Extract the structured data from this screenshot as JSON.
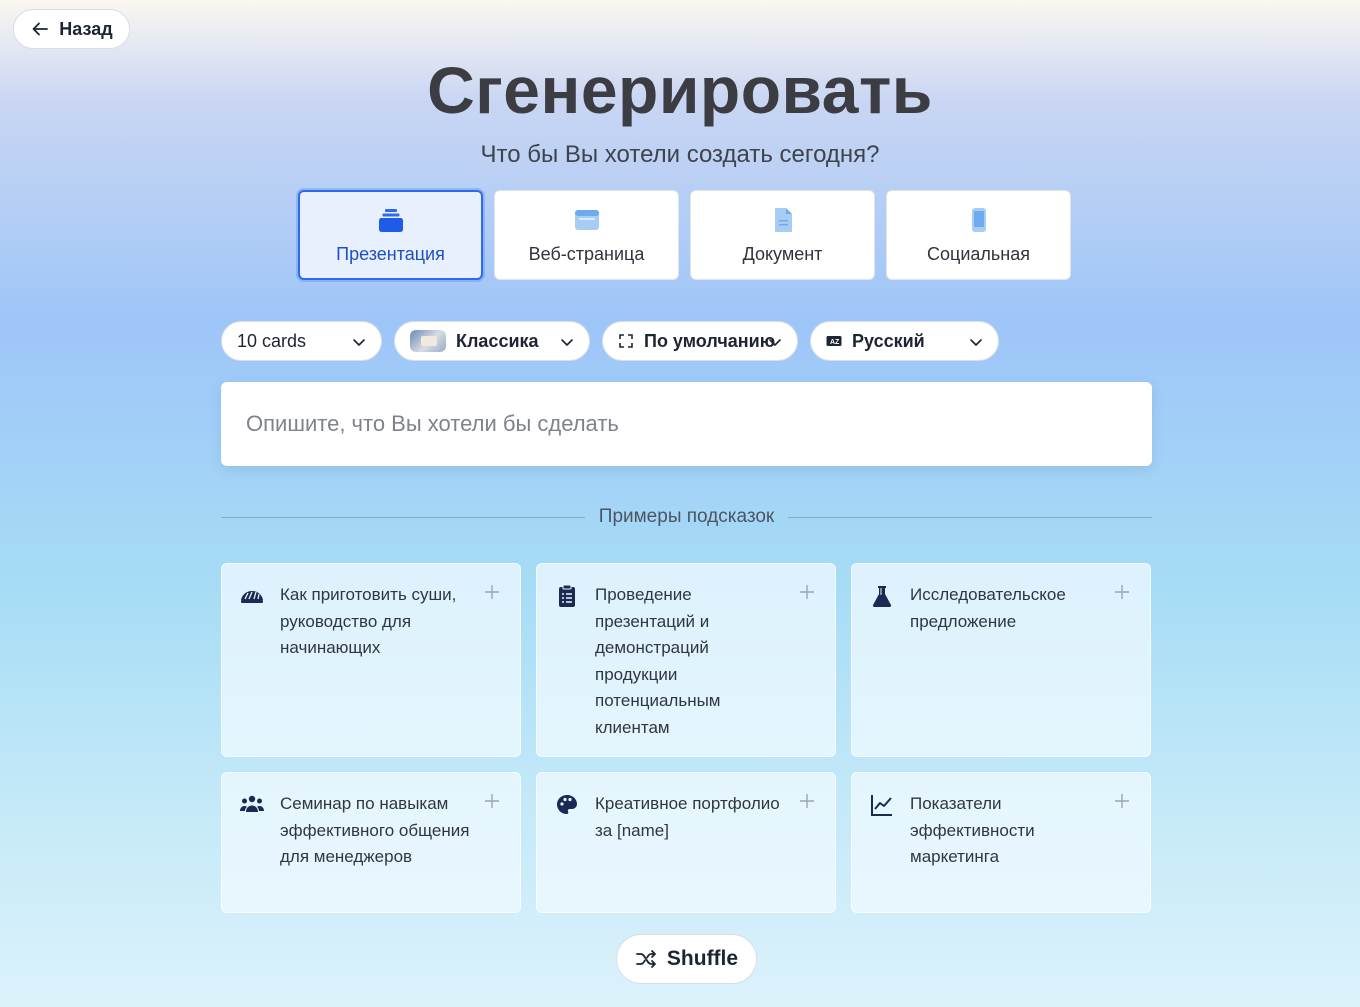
{
  "nav": {
    "back_label": "Назад"
  },
  "header": {
    "title": "Сгенерировать",
    "subtitle": "Что бы Вы хотели создать сегодня?"
  },
  "types": [
    {
      "label": "Презентация",
      "icon": "stack-icon",
      "selected": true
    },
    {
      "label": "Веб-страница",
      "icon": "browser-icon",
      "selected": false
    },
    {
      "label": "Документ",
      "icon": "document-icon",
      "selected": false
    },
    {
      "label": "Социальная",
      "icon": "phone-icon",
      "selected": false
    }
  ],
  "options": {
    "cards": "10 cards",
    "theme": "Классика",
    "size": "По умолчанию",
    "language": "Русский"
  },
  "prompt": {
    "placeholder": "Опишите, что Вы хотели бы сделать"
  },
  "examples": {
    "heading": "Примеры подсказок",
    "items": [
      {
        "text": "Как приготовить суши, руководство для начинающих",
        "icon": "sushi-icon"
      },
      {
        "text": "Проведение презентаций и демонстраций продукции потенциальным клиентам",
        "icon": "clipboard-icon"
      },
      {
        "text": "Исследовательское предложение",
        "icon": "flask-icon"
      },
      {
        "text": "Семинар по навыкам эффективного общения для менеджеров",
        "icon": "people-icon"
      },
      {
        "text": "Креативное портфолио за [name]",
        "icon": "palette-icon"
      },
      {
        "text": "Показатели эффективности маркетинга",
        "icon": "line-chart-icon"
      }
    ]
  },
  "shuffle_label": "Shuffle",
  "colors": {
    "accent": "#2e6bec",
    "icon": "#1b2a55"
  }
}
